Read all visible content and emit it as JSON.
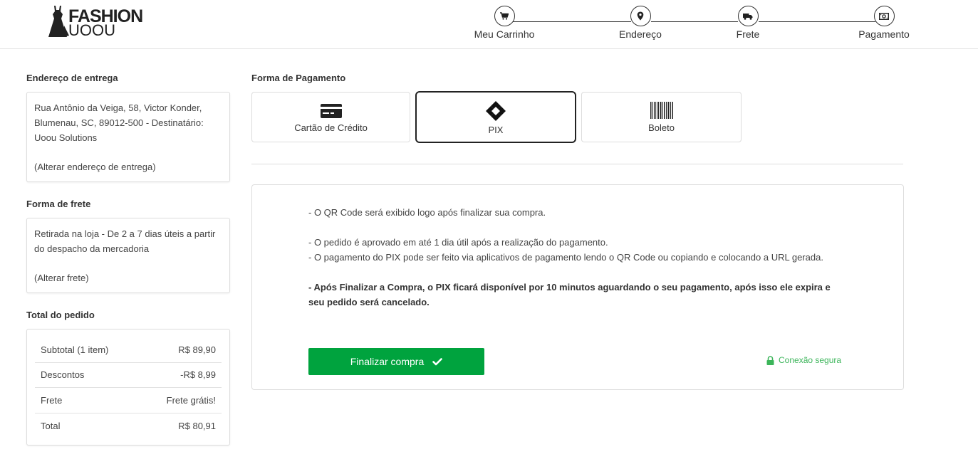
{
  "header": {
    "brand_line1": "FASHION",
    "brand_line2": "UOOU",
    "steps": [
      {
        "label": "Meu Carrinho",
        "icon": "cart-icon"
      },
      {
        "label": "Endereço",
        "icon": "map-pin-icon"
      },
      {
        "label": "Frete",
        "icon": "truck-icon"
      },
      {
        "label": "Pagamento",
        "icon": "money-icon"
      }
    ]
  },
  "delivery": {
    "title": "Endereço de entrega",
    "address": "Rua Antônio da Veiga, 58, Victor Konder, Blumenau, SC, 89012-500 - Destinatário: Uoou Solutions",
    "change_link": "(Alterar endereço de entrega)"
  },
  "shipping": {
    "title": "Forma de frete",
    "description": "Retirada na loja - De 2 a 7 dias úteis a partir do despacho da mercadoria",
    "change_link": "(Alterar frete)"
  },
  "totals": {
    "title": "Total do pedido",
    "rows": [
      {
        "label": "Subtotal (1 item)",
        "value": "R$ 89,90"
      },
      {
        "label": "Descontos",
        "value": "-R$ 8,99"
      },
      {
        "label": "Frete",
        "value": "Frete grátis!"
      },
      {
        "label": "Total",
        "value": "R$ 80,91"
      }
    ]
  },
  "payment": {
    "title": "Forma de Pagamento",
    "options": [
      {
        "label": "Cartão de Crédito",
        "icon": "credit-card-icon"
      },
      {
        "label": "PIX",
        "icon": "pix-icon"
      },
      {
        "label": "Boleto",
        "icon": "barcode-icon"
      }
    ],
    "selected": "PIX",
    "info": {
      "line1": "- O QR Code será exibido logo após finalizar sua compra.",
      "line2": "- O pedido é aprovado em até 1 dia útil após a realização do pagamento.",
      "line3": "- O pagamento do PIX pode ser feito via aplicativos de pagamento lendo o QR Code ou copiando e colocando a URL gerada.",
      "line4": "- Após Finalizar a Compra, o PIX ficará disponível por 10 minutos aguardando o seu pagamento, após isso ele expira e seu pedido será cancelado."
    },
    "finish_button": "Finalizar compra",
    "secure_label": "Conexão segura"
  },
  "colors": {
    "accent_green": "#00a33e",
    "secure_green": "#3cb55a",
    "text_dark": "#333333"
  }
}
